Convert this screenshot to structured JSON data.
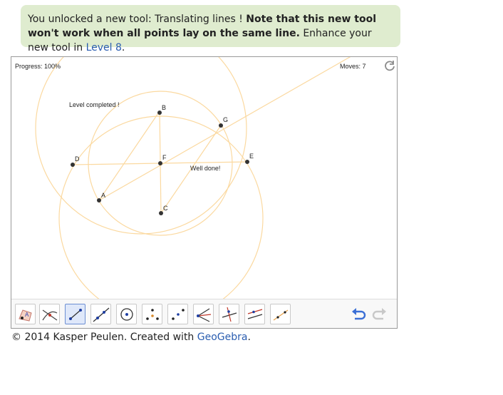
{
  "banner": {
    "text1": "You unlocked a new tool: Translating lines ! ",
    "bold": "Note that this new tool won't work when all points lay on the same line.",
    "text2": " Enhance your new tool in ",
    "link": "Level 8",
    "text3": "."
  },
  "applet": {
    "progress": "Progress: 100%",
    "moves": "Moves: 7",
    "level_completed": "Level completed !",
    "well_done": "Well done!",
    "points": [
      "A",
      "B",
      "C",
      "D",
      "E",
      "F",
      "G"
    ]
  },
  "toolbar": {
    "tools": [
      "move-tool",
      "intersect-tool",
      "segment-tool",
      "line-tool",
      "circle-tool",
      "triangle-tool",
      "midpoint-tool",
      "angle-bisector-tool",
      "perpendicular-line-tool",
      "parallel-line-tool",
      "translate-line-tool"
    ],
    "active_tool": "segment-tool"
  },
  "footer": {
    "text": "© 2014 Kasper Peulen. Created with ",
    "link": "GeoGebra",
    "end": "."
  },
  "colors": {
    "banner_bg": "#dfeccf",
    "link": "#2a5db0",
    "construction": "#fbd9a0",
    "point": "#333333",
    "undo": "#3b6fd6"
  }
}
